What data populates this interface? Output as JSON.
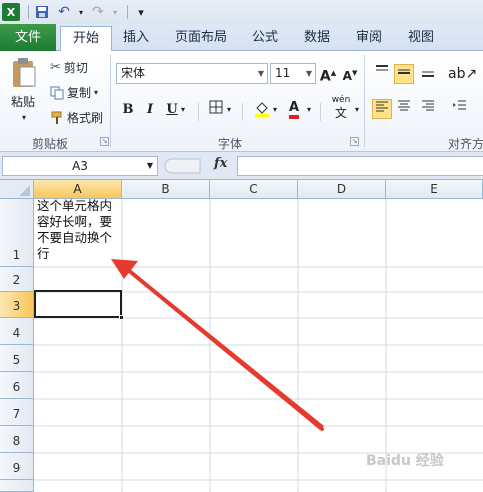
{
  "qat": {
    "excel_icon_text": "X",
    "undo": "↶",
    "redo": "↷",
    "customize": "▾"
  },
  "tabs": [
    "文件",
    "开始",
    "插入",
    "页面布局",
    "公式",
    "数据",
    "审阅",
    "视图"
  ],
  "clipboard": {
    "paste": "粘贴",
    "cut": "剪切",
    "copy": "复制",
    "format_painter": "格式刷",
    "group_label": "剪贴板"
  },
  "font": {
    "name": "宋体",
    "size": "11",
    "grow": "A",
    "shrink": "A",
    "bold": "B",
    "italic": "I",
    "underline": "U",
    "font_color": "A",
    "wen": "wén",
    "wen_char": "文",
    "group_label": "字体"
  },
  "alignment": {
    "group_label": "对齐方"
  },
  "formula_bar": {
    "name_box": "A3",
    "fx": "fx",
    "value": ""
  },
  "columns": [
    "A",
    "B",
    "C",
    "D",
    "E"
  ],
  "rows": [
    "1",
    "2",
    "3",
    "4",
    "5",
    "6",
    "7",
    "8",
    "9"
  ],
  "cells": {
    "A1": "这个单元格内容好长啊，要不要自动换个行"
  },
  "selected_cell": "A3",
  "watermark": "Baidu 经验",
  "colors": {
    "accent": "#1e7b34",
    "arrow": "#e53a2e",
    "selection": "#f7c75a"
  }
}
